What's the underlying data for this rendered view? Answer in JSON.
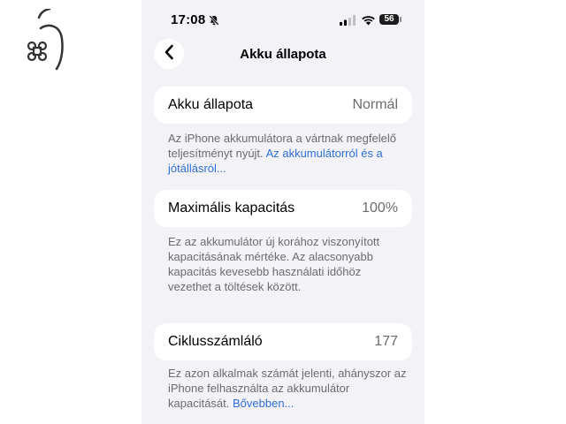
{
  "status_bar": {
    "time": "17:08",
    "battery": "56"
  },
  "nav": {
    "title": "Akku állapota"
  },
  "battery_health": {
    "label": "Akku állapota",
    "value": "Normál",
    "description": "Az iPhone akkumulátora a vártnak megfelelő teljesítményt nyújt.",
    "link": "Az akkumulátorról és a jótállásról..."
  },
  "max_capacity": {
    "label": "Maximális kapacitás",
    "value": "100%",
    "description": "Ez az akkumulátor új korához viszonyított kapacitásának mértéke. Az alacsonyabb kapacitás kevesebb használati időhöz vezethet a töltések között."
  },
  "cycle_count": {
    "label": "Ciklusszámláló",
    "value": "177",
    "description": "Ez azon alkalmak számát jelenti, ahányszor az iPhone felhasználta az akkumulátor kapacitását.",
    "link": "Bővebben..."
  },
  "icons": {
    "logo": "apple-command-logo",
    "back": "chevron-left-icon",
    "mute": "bell-slash-icon",
    "signal": "cellular-signal-icon",
    "wifi": "wifi-icon",
    "battery": "battery-icon"
  },
  "colors": {
    "background": "#f2f2f7",
    "card": "#ffffff",
    "link": "#2f6fd6",
    "secondary_text": "#6c6c70"
  }
}
